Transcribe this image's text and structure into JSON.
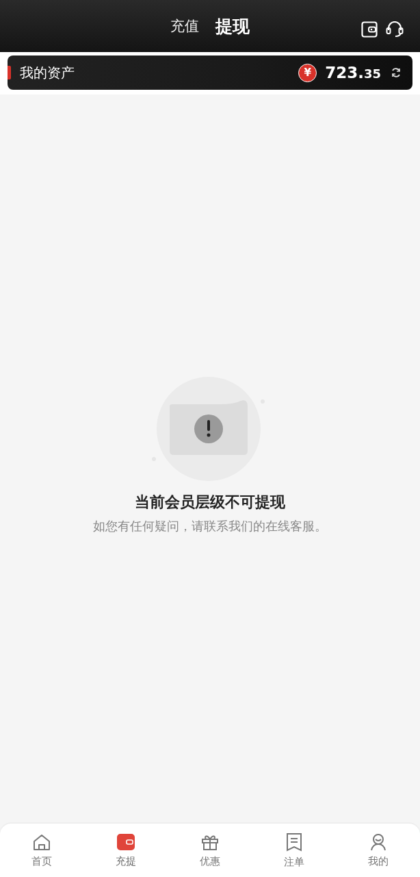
{
  "tabs": [
    {
      "label": "充值",
      "selected": false
    },
    {
      "label": "提现",
      "selected": true
    }
  ],
  "assets": {
    "label": "我的资产",
    "currency": "¥",
    "amount_whole": "723.",
    "amount_fraction": "35"
  },
  "empty_state": {
    "title": "当前会员层级不可提现",
    "message": "如您有任何疑问，请联系我们的在线客服。"
  },
  "nav": [
    {
      "kind": "home",
      "label": "首页",
      "selected": false
    },
    {
      "kind": "wallet",
      "label": "充提",
      "selected": true
    },
    {
      "kind": "gift",
      "label": "优惠",
      "selected": false
    },
    {
      "kind": "receipt",
      "label": "注单",
      "selected": false
    },
    {
      "kind": "user",
      "label": "我的",
      "selected": false
    }
  ]
}
